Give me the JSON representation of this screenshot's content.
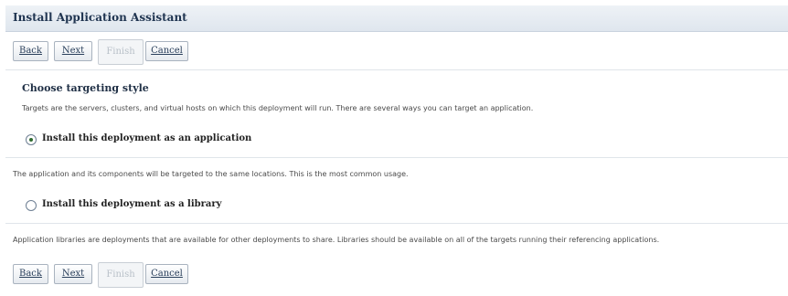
{
  "window": {
    "title": "Install Application Assistant"
  },
  "buttons_top": {
    "back": "Back",
    "next": "Next",
    "finish": "Finish",
    "cancel": "Cancel"
  },
  "buttons_bottom": {
    "back": "Back",
    "next": "Next",
    "finish": "Finish",
    "cancel": "Cancel"
  },
  "section": {
    "title": "Choose targeting style",
    "description": "Targets are the servers, clusters, and virtual hosts on which this deployment will run. There are several ways you can target an application."
  },
  "options": [
    {
      "label": "Install this deployment as an application",
      "selected": true,
      "description": "The application and its components will be targeted to the same locations. This is the most common usage."
    },
    {
      "label": "Install this deployment as a library",
      "selected": false,
      "description": "Application libraries are deployments that are available for other deployments to share. Libraries should be available on all of the targets running their referencing applications."
    }
  ]
}
